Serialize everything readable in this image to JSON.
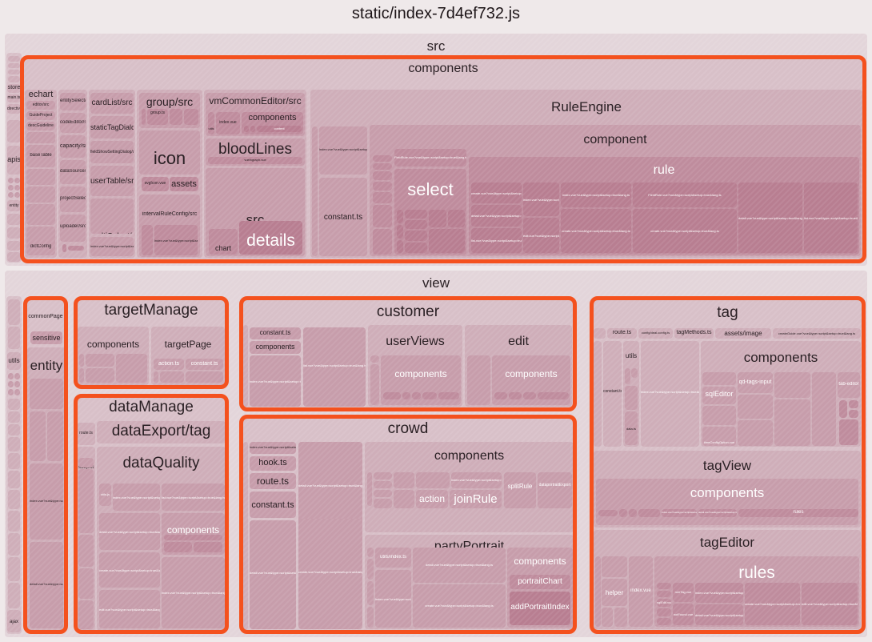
{
  "title": "static/index-7d4ef732.js",
  "colors": {
    "page_background": "#efe9ea",
    "highlight_ring": "#f4511e",
    "node_base": "#d8c0c8",
    "label_dark": "#2a2024",
    "label_light": "#ffffff"
  },
  "chart_data": {
    "type": "treemap",
    "title": "static/index-7d4ef732.js",
    "description": "Bundle analyzer treemap of a JavaScript build artifact. Rectangle area is proportional to module size; nesting shows directory structure. Orange rings highlight matched/selected directories.",
    "root": "static/index-7d4ef732.js",
    "top_level_groups": [
      "src",
      "view"
    ],
    "highlighted_groups": [
      "components",
      "commonPage/entity",
      "targetManage",
      "dataManage",
      "customer",
      "crowd",
      "tag"
    ],
    "legend": "none",
    "grid": false
  },
  "labels": {
    "src": "src",
    "components": "components",
    "view": "view",
    "store": "store",
    "main_ts": "main.ts",
    "directives": "directives",
    "apis": "apis",
    "entity_small": "entity",
    "utils_left": "utils",
    "ajax": "ajax",
    "echart": "echart",
    "editor_src": "editor/src",
    "guideproject": "GuideProject",
    "descguideline": "descGuideline",
    "baseTable": "baseTable",
    "dictConfig": "dictConfig",
    "entitySelect_src": "entitySelect/src",
    "codeEditor_src": "codeEditor/src",
    "capacity_src": "capacity/src",
    "dataSource_src": "dataSource/src",
    "projectSelect_src": "projectSelect/src",
    "uploader_src": "uploader/src",
    "cardList_src": "cardList/src",
    "staticTagDialog": "staticTagDialog",
    "fieldShowSettingDialog_src": "fieldShowSettingDialog/src",
    "userTable_src": "userTable/src",
    "multiSelect_src": "multiSelect/src",
    "group_src": "group/src",
    "group_ts": "group.ts",
    "icon": "icon",
    "svgIcon_vue": "svgIcon.vue",
    "assets": "assets",
    "intervalRuleConfig_src": "intervalRuleConfig/src",
    "vmCommonEditor_src": "vmCommonEditor/src",
    "utils_vce": "utils",
    "index_vue": "index.vue",
    "components_vce": "components",
    "content": "content",
    "bloodLines": "bloodLines",
    "vuelngraph": "vuelngraph.vue",
    "src_bl": "src",
    "chart": "chart",
    "details": "details",
    "constant_ts": "constant.ts",
    "RuleEngine": "RuleEngine",
    "component": "component",
    "rule": "rule",
    "select": "select",
    "fieldRule_vue": "FieldRule.vue?vue&type=script&setup=true&lang.ts",
    "commonPage": "commonPage",
    "sensitive": "sensitive",
    "entity": "entity",
    "targetManage": "targetManage",
    "tm_components": "components",
    "targetPage": "targetPage",
    "action_ts": "action.ts",
    "tp_constant_ts": "constant.ts",
    "dataManage": "dataManage",
    "route_ts": "route.ts",
    "dataExport_tag": "dataExport/tag",
    "subject": "subject",
    "dataQuality": "dataQuality",
    "utils_js": "utils.js",
    "dq_components": "components",
    "customer": "customer",
    "cu_constant_ts": "constant.ts",
    "cu_components": "components",
    "userViews": "userViews",
    "uv_components": "components",
    "edit": "edit",
    "ed_components": "components",
    "crowd": "crowd",
    "hook_ts": "hook.ts",
    "cr_route_ts": "route.ts",
    "cr_constant_ts": "constant.ts",
    "cr_components": "components",
    "action": "action",
    "joinRule": "joinRule",
    "splitRule": "splitRule",
    "dataportraitExport": "dataportraitExport",
    "partyPortrait": "partyPortrait",
    "utils_index_ts": "utils/index.ts",
    "pp_components": "components",
    "portraitChart": "portraitChart",
    "addPortraitIndex": "addPortraitIndex",
    "tag": "tag",
    "tag_route_ts": "route.ts",
    "config_deal_config_ts": "config/deal.config.ts",
    "tagMethods_ts": "tagMethods.ts",
    "assets_image": "assets/image",
    "createGuide_vue": "createGuide.vue?vue&type=script&setup=true&lang.ts",
    "tag_utils": "utils",
    "tag_constant_ts": "constant.ts",
    "data_ts": "data.ts",
    "tag_components": "components",
    "sqlEditor": "sqlEditor",
    "qd_tags_input": "qd-tags-input",
    "tab_editor": "tab-editor",
    "timeConfigOption_vue": "timeConfigOption.vue",
    "tagView": "tagView",
    "tv_components": "components",
    "tv_rules": "rules",
    "tagEditor": "tagEditor",
    "te_rules": "rules",
    "helper": "helper",
    "te_index_vue": "index.vue",
    "sqlEdit_vue": "sqlEdit.vue",
    "notFound_vue": "notFound.vue",
    "ruleTag_vue": "ruleTag.vue",
    "detail_vue_long": "detail.vue?vue&type=script&setup=true&lang.ts",
    "create_vue_long": "create.vue?vue&type=script&setup=true&lang.ts",
    "index_vue_long": "index.vue?vue&type=script&setup=true&lang.ts",
    "list_vue_long": "list.vue?vue&type=script&setup=true&lang.ts",
    "edit_vue_long": "edit.vue?vue&type=script&setup=true&lang.ts",
    "blank": ""
  }
}
